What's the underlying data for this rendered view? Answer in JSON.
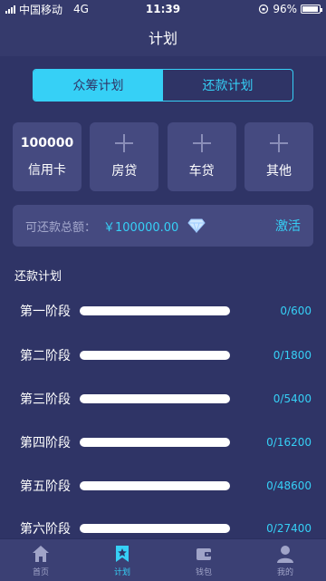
{
  "status": {
    "carrier": "中国移动",
    "network": "4G",
    "time": "11:39",
    "battery": "96%",
    "battery_level": 0.96
  },
  "header": {
    "title": "计划"
  },
  "segments": [
    {
      "label": "众筹计划",
      "active": true
    },
    {
      "label": "还款计划",
      "active": false
    }
  ],
  "cards": [
    {
      "amount": "100000",
      "label": "信用卡"
    },
    {
      "label": "房贷"
    },
    {
      "label": "车贷"
    },
    {
      "label": "其他"
    }
  ],
  "total": {
    "label": "可还款总额：",
    "amount": "￥100000.00",
    "action": "激活"
  },
  "plan": {
    "title": "还款计划",
    "stages": [
      {
        "name": "第一阶段",
        "value": "0/600",
        "progress": 0
      },
      {
        "name": "第二阶段",
        "value": "0/1800",
        "progress": 0
      },
      {
        "name": "第三阶段",
        "value": "0/5400",
        "progress": 0
      },
      {
        "name": "第四阶段",
        "value": "0/16200",
        "progress": 0
      },
      {
        "name": "第五阶段",
        "value": "0/48600",
        "progress": 0
      },
      {
        "name": "第六阶段",
        "value": "0/27400",
        "progress": 0
      }
    ]
  },
  "tabs": [
    {
      "label": "首页",
      "icon": "home-icon"
    },
    {
      "label": "计划",
      "icon": "bookmark-star-icon",
      "active": true
    },
    {
      "label": "钱包",
      "icon": "wallet-icon"
    },
    {
      "label": "我的",
      "icon": "user-icon"
    }
  ],
  "colors": {
    "accent": "#36d0f6",
    "background": "#2f3466",
    "card": "#454a80"
  }
}
